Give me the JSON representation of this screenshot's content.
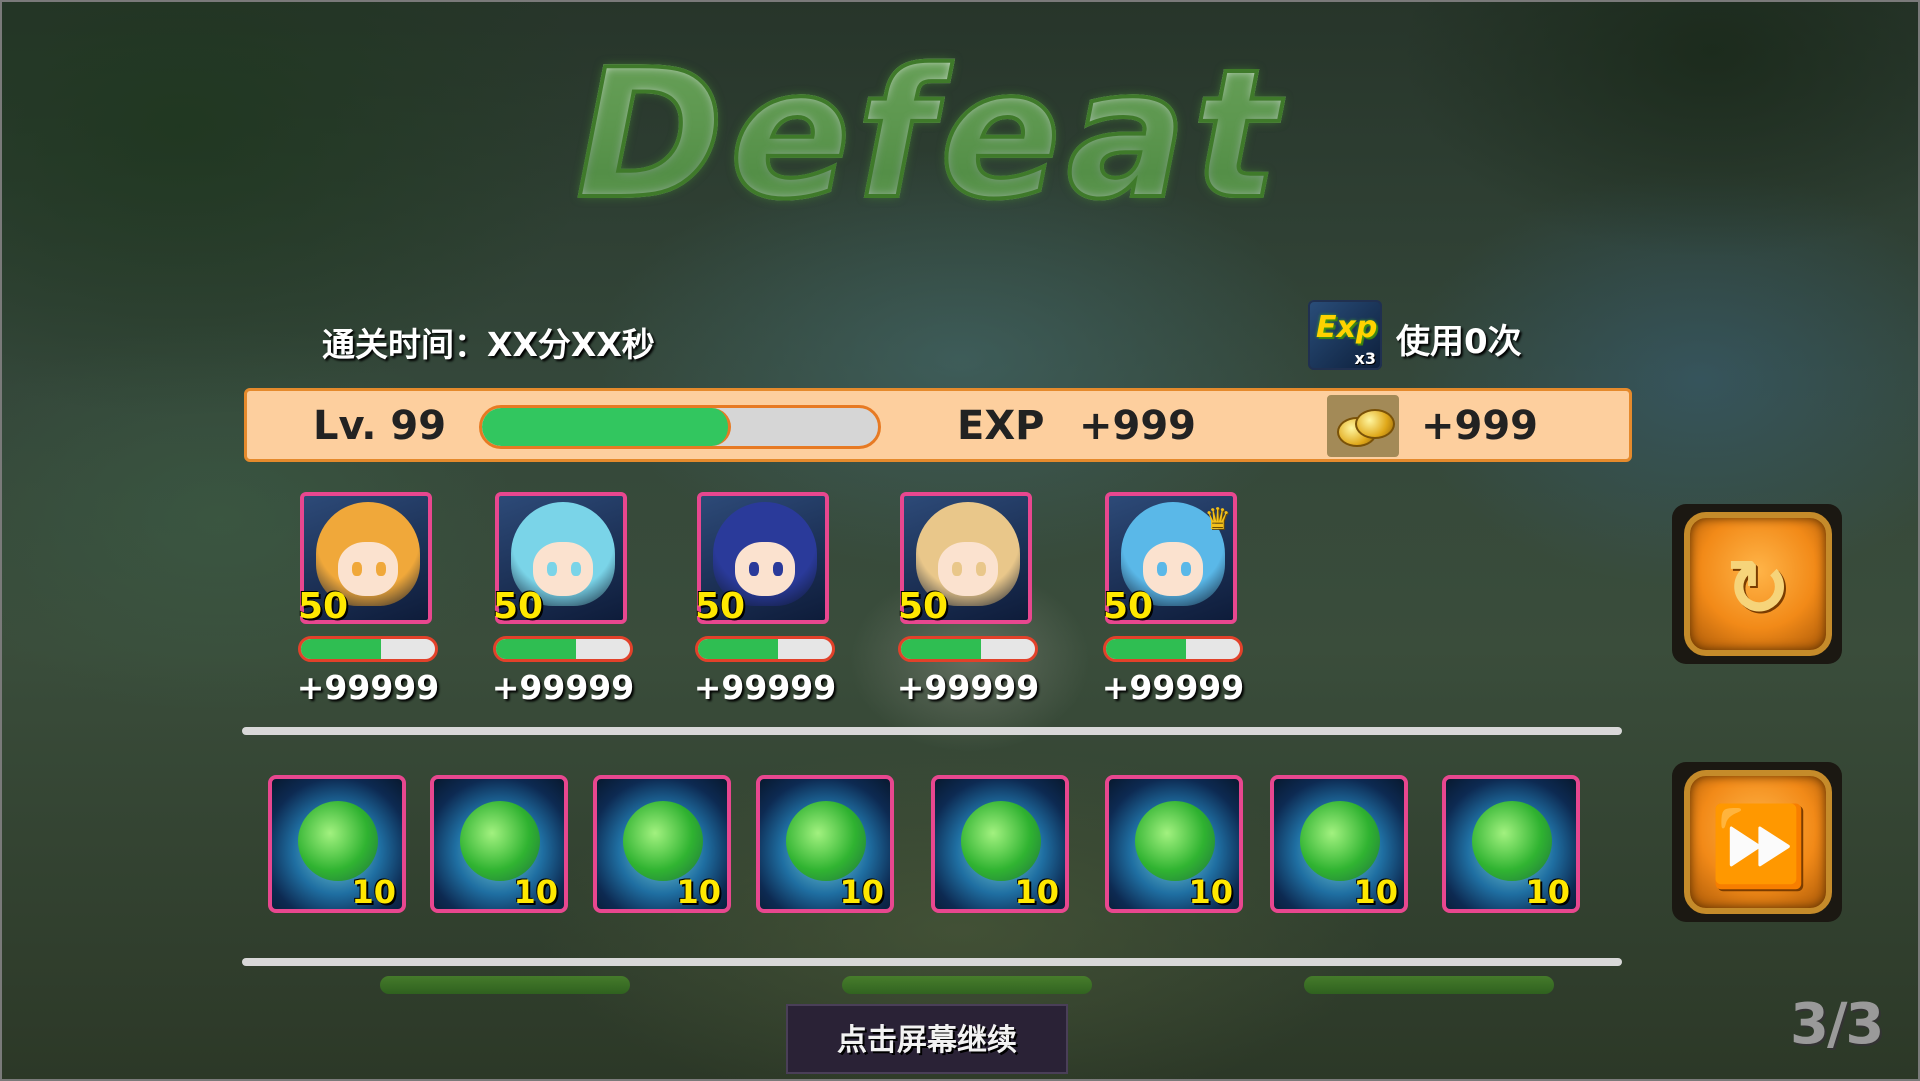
{
  "title": "Defeat",
  "clear_time": "通关时间：XX分XX秒",
  "exp_boost": {
    "icon": "exp-x3-icon",
    "icon_text": "Exp",
    "multiplier": "x3",
    "usage": "使用0次"
  },
  "player": {
    "level": "Lv. 99",
    "progress": 0.63,
    "exp_label": "EXP",
    "exp_gain": "+999",
    "gold_icon": "gold-coins-icon",
    "gold_gain": "+999"
  },
  "heroes": [
    {
      "level": "50",
      "progress": 0.6,
      "gain": "+99999",
      "hair": "#f0a83a"
    },
    {
      "level": "50",
      "progress": 0.6,
      "gain": "+99999",
      "hair": "#7ad4e8"
    },
    {
      "level": "50",
      "progress": 0.6,
      "gain": "+99999",
      "hair": "#2a3a9a"
    },
    {
      "level": "50",
      "progress": 0.6,
      "gain": "+99999",
      "hair": "#e9c78a"
    },
    {
      "level": "50",
      "progress": 0.6,
      "gain": "+99999",
      "hair": "#5ab8e8",
      "crown": "♛"
    }
  ],
  "items": [
    {
      "icon": "green-orb-icon",
      "count": "10"
    },
    {
      "icon": "green-orb-icon",
      "count": "10"
    },
    {
      "icon": "green-orb-icon",
      "count": "10"
    },
    {
      "icon": "green-orb-icon",
      "count": "10"
    },
    {
      "icon": "green-orb-icon",
      "count": "10"
    },
    {
      "icon": "green-orb-icon",
      "count": "10"
    },
    {
      "icon": "green-orb-icon",
      "count": "10"
    },
    {
      "icon": "green-orb-icon",
      "count": "10"
    }
  ],
  "buttons": {
    "retry_icon": "↻",
    "skip_icon": "⏩"
  },
  "continue_text": "点击屏幕继续",
  "page_indicator": "3/3",
  "colors": {
    "accent_pink": "#e8478f",
    "bar_green": "#32c65f",
    "info_bar": "#fdcf9e",
    "hero_level": "#ffe800"
  }
}
